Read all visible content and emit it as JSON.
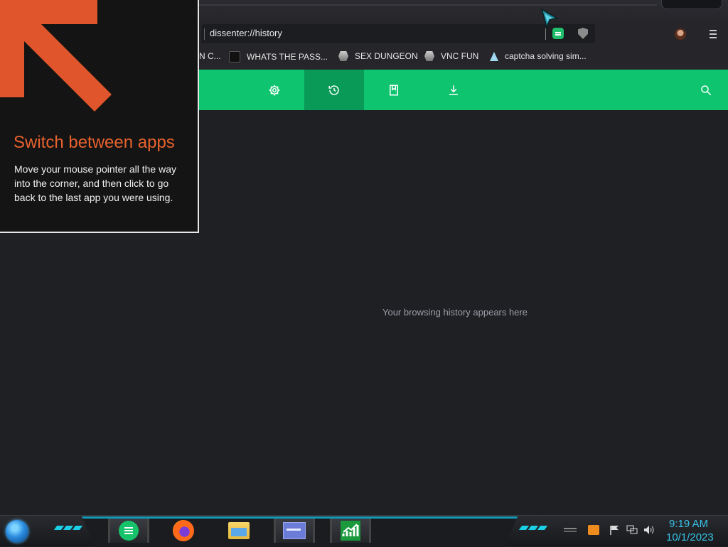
{
  "browser": {
    "address": "dissenter://history",
    "bookmarks": [
      {
        "label": "N C...",
        "icon": "bookmark-icon"
      },
      {
        "label": "WHATS THE PASS...",
        "icon": "dark-square-icon"
      },
      {
        "label": "SEX DUNGEON",
        "icon": "sticker-icon"
      },
      {
        "label": "VNC FUN",
        "icon": "sticker-icon"
      },
      {
        "label": "captcha solving sim...",
        "icon": "caret-logo-icon"
      }
    ],
    "extensions": [
      "chat-extension-icon",
      "shield-icon"
    ]
  },
  "history_page": {
    "nav": [
      {
        "name": "settings",
        "icon": "gear-icon"
      },
      {
        "name": "history",
        "icon": "history-icon",
        "active": true
      },
      {
        "name": "bookmarks",
        "icon": "bookmark-icon"
      },
      {
        "name": "downloads",
        "icon": "download-icon"
      },
      {
        "name": "search",
        "icon": "search-icon"
      }
    ],
    "empty_message": "Your browsing history appears here"
  },
  "tip": {
    "title": "Switch between apps",
    "body": "Move your mouse pointer all the way into the corner, and then click to go back to the last app you were using.",
    "accent_color": "#e8622e"
  },
  "taskbar": {
    "apps": [
      "chat-app-icon",
      "firefox-icon",
      "file-explorer-icon",
      "window-app-icon",
      "stocks-app-icon"
    ],
    "tray_icons": [
      "notes-icon",
      "flag-icon",
      "network-icon",
      "volume-icon"
    ],
    "clock": {
      "time": "9:19 AM",
      "date": "10/1/2023"
    }
  },
  "colors": {
    "accent_green": "#0ec46f",
    "active_green": "#0a9a57",
    "clock": "#36c3e6"
  }
}
